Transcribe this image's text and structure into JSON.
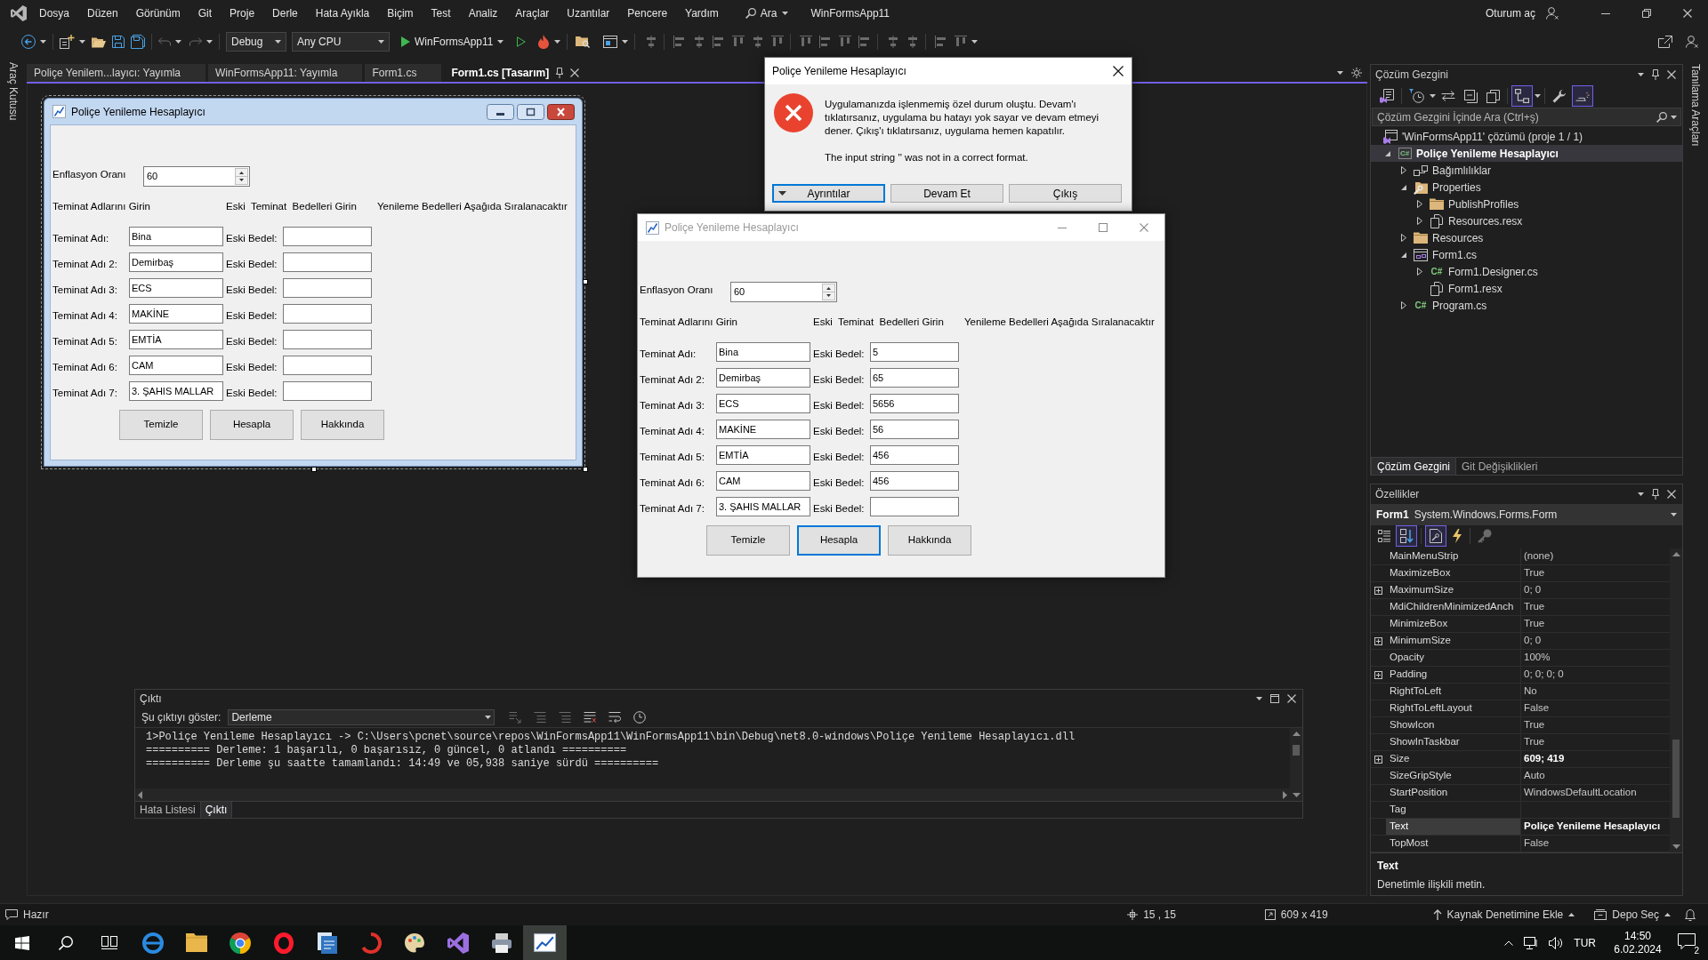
{
  "menu_bar": {
    "items": [
      "Dosya",
      "Düzen",
      "Görünüm",
      "Git",
      "Proje",
      "Derle",
      "Hata Ayıkla",
      "Biçim",
      "Test",
      "Analiz",
      "Araçlar",
      "Uzantılar",
      "Pencere",
      "Yardım"
    ],
    "search": "Ara",
    "solution_name": "WinFormsApp11",
    "sign_in": "Oturum aç"
  },
  "toolbar": {
    "configuration": "Debug",
    "platform": "Any CPU",
    "start_target": "WinFormsApp11"
  },
  "left_side_tab": "Araç Kutusu",
  "document_tabs": [
    {
      "label": "Poliçe Yenilem...layıcı: Yayımla",
      "selected": false
    },
    {
      "label": "WinFormsApp11: Yayımla",
      "selected": false
    },
    {
      "label": "Form1.cs",
      "selected": false
    },
    {
      "label": "Form1.cs [Tasarım]",
      "selected": true
    }
  ],
  "designer_form": {
    "selected": true,
    "title": "Poliçe Yenileme Hesaplayıcı",
    "inflation_label": "Enflasyon Oranı",
    "inflation_value": "60",
    "headers": [
      "Teminat Adlarını Girin",
      "Eski  Teminat  Bedelleri Girin",
      "Yenileme Bedelleri Aşağıda Sıralanacaktır"
    ],
    "rows": [
      {
        "name_label": "Teminat Adı:",
        "name_value": "Bina",
        "old_label": "Eski Bedel:"
      },
      {
        "name_label": "Teminat Adı 2:",
        "name_value": "Demirbaş",
        "old_label": "Eski Bedel:"
      },
      {
        "name_label": "Teminat Adı 3:",
        "name_value": "ECS",
        "old_label": "Eski Bedel:"
      },
      {
        "name_label": "Teminat Adı 4:",
        "name_value": "MAKİNE",
        "old_label": "Eski Bedel:"
      },
      {
        "name_label": "Teminat Adı 5:",
        "name_value": "EMTİA",
        "old_label": "Eski Bedel:"
      },
      {
        "name_label": "Teminat Adı 6:",
        "name_value": "CAM",
        "old_label": "Eski Bedel:"
      },
      {
        "name_label": "Teminat Adı 7:",
        "name_value": "3. ŞAHIS MALLAR",
        "old_label": "Eski Bedel:"
      }
    ],
    "buttons": [
      {
        "label": "Temizle",
        "focused": false
      },
      {
        "label": "Hesapla",
        "focused": false
      },
      {
        "label": "Hakkında",
        "focused": false
      }
    ]
  },
  "error_dialog": {
    "title": "Poliçe Yenileme Hesaplayıcı",
    "message": "Uygulamanızda işlenmemiş özel durum oluştu. Devam'ı tıklatırsanız, uygulama bu hatayı yok sayar ve devam etmeyi dener. Çıkış'ı tıklatırsanız, uygulama hemen kapatılır.",
    "detail": "The input string '' was not in a correct format.",
    "buttons": [
      {
        "label": "Ayrıntılar",
        "kind": "expander",
        "focused": true
      },
      {
        "label": "Devam Et",
        "kind": "plain",
        "focused": false
      },
      {
        "label": "Çıkış",
        "kind": "plain",
        "focused": false
      }
    ]
  },
  "running_form": {
    "active": false,
    "title": "Poliçe Yenileme Hesaplayıcı",
    "inflation_label": "Enflasyon Oranı",
    "inflation_value": "60",
    "headers": [
      "Teminat Adlarını Girin",
      "Eski  Teminat  Bedelleri Girin",
      "Yenileme Bedelleri Aşağıda Sıralanacaktır"
    ],
    "rows": [
      {
        "name_label": "Teminat Adı:",
        "name_value": "Bina",
        "old_label": "Eski Bedel:",
        "old_value": "5"
      },
      {
        "name_label": "Teminat Adı 2:",
        "name_value": "Demirbaş",
        "old_label": "Eski Bedel:",
        "old_value": "65"
      },
      {
        "name_label": "Teminat Adı 3:",
        "name_value": "ECS",
        "old_label": "Eski Bedel:",
        "old_value": "5656"
      },
      {
        "name_label": "Teminat Adı 4:",
        "name_value": "MAKİNE",
        "old_label": "Eski Bedel:",
        "old_value": "56"
      },
      {
        "name_label": "Teminat Adı 5:",
        "name_value": "EMTİA",
        "old_label": "Eski Bedel:",
        "old_value": "456"
      },
      {
        "name_label": "Teminat Adı 6:",
        "name_value": "CAM",
        "old_label": "Eski Bedel:",
        "old_value": "456"
      },
      {
        "name_label": "Teminat Adı 7:",
        "name_value": "3. ŞAHIS MALLAR",
        "old_label": "Eski Bedel:"
      }
    ],
    "buttons": [
      {
        "label": "Temizle",
        "focused": false
      },
      {
        "label": "Hesapla",
        "focused": true
      },
      {
        "label": "Hakkında",
        "focused": false
      }
    ]
  },
  "solution_explorer": {
    "title": "Çözüm Gezgini",
    "toolbar": [
      {
        "kind": "views",
        "selected": false
      },
      {
        "kind": "filter",
        "selected": false
      },
      {
        "kind": "sync",
        "selected": false
      },
      {
        "kind": "collapse",
        "selected": false
      },
      {
        "kind": "copy",
        "selected": false
      },
      {
        "kind": "tree",
        "selected": true
      },
      {
        "kind": "wrench",
        "selected": false
      },
      {
        "kind": "preview",
        "selected": true
      }
    ],
    "search_placeholder": "Çözüm Gezgini İçinde Ara (Ctrl+ş)",
    "tree": [
      {
        "label": "'WinFormsApp11' çözümü (proje 1 / 1)",
        "kind": "solution",
        "selected": false,
        "children": [
          {
            "label": "Poliçe Yenileme Hesaplayıcı",
            "kind": "project",
            "badge": "C#",
            "expanded": true,
            "selected": true,
            "children": [
              {
                "label": "Bağımlılıklar",
                "kind": "dependencies",
                "expanded": false,
                "selected": false
              },
              {
                "label": "Properties",
                "kind": "properties",
                "expanded": true,
                "selected": false,
                "children": [
                  {
                    "label": "PublishProfiles",
                    "kind": "folder",
                    "expanded": false,
                    "selected": false
                  },
                  {
                    "label": "Resources.resx",
                    "kind": "resource",
                    "expanded": false,
                    "selected": false
                  }
                ]
              },
              {
                "label": "Resources",
                "kind": "folder",
                "expanded": false,
                "selected": false
              },
              {
                "label": "Form1.cs",
                "kind": "form",
                "expanded": true,
                "selected": false,
                "children": [
                  {
                    "label": "Form1.Designer.cs",
                    "kind": "csharp",
                    "badge": "C#",
                    "expanded": false,
                    "selected": false
                  },
                  {
                    "label": "Form1.resx",
                    "kind": "resource",
                    "selected": false
                  }
                ]
              },
              {
                "label": "Program.cs",
                "kind": "csharp",
                "badge": "C#",
                "expanded": false,
                "selected": false
              }
            ]
          }
        ]
      }
    ],
    "tabs": [
      {
        "label": "Çözüm Gezgini",
        "selected": true
      },
      {
        "label": "Git Değişiklikleri",
        "selected": false
      }
    ]
  },
  "properties": {
    "title": "Özellikler",
    "object_name": "Form1",
    "object_type": "System.Windows.Forms.Form",
    "toolbar": [
      {
        "kind": "categorized",
        "selected": false
      },
      {
        "kind": "alphabetical",
        "selected": true
      },
      {
        "kind": "properties",
        "selected": true
      },
      {
        "kind": "events",
        "selected": false
      },
      {
        "kind": "pages",
        "selected": false
      }
    ],
    "rows": [
      {
        "name": "MainMenuStrip",
        "value": "(none)",
        "expandable": false,
        "modified": false,
        "selected": false
      },
      {
        "name": "MaximizeBox",
        "value": "True",
        "expandable": false,
        "modified": false,
        "selected": false
      },
      {
        "name": "MaximumSize",
        "value": "0; 0",
        "expandable": true,
        "modified": false,
        "selected": false
      },
      {
        "name": "MdiChildrenMinimizedAnch",
        "value": "True",
        "expandable": false,
        "modified": false,
        "selected": false
      },
      {
        "name": "MinimizeBox",
        "value": "True",
        "expandable": false,
        "modified": false,
        "selected": false
      },
      {
        "name": "MinimumSize",
        "value": "0; 0",
        "expandable": true,
        "modified": false,
        "selected": false
      },
      {
        "name": "Opacity",
        "value": "100%",
        "expandable": false,
        "modified": false,
        "selected": false
      },
      {
        "name": "Padding",
        "value": "0; 0; 0; 0",
        "expandable": true,
        "modified": false,
        "selected": false
      },
      {
        "name": "RightToLeft",
        "value": "No",
        "expandable": false,
        "modified": false,
        "selected": false
      },
      {
        "name": "RightToLeftLayout",
        "value": "False",
        "expandable": false,
        "modified": false,
        "selected": false
      },
      {
        "name": "ShowIcon",
        "value": "True",
        "expandable": false,
        "modified": false,
        "selected": false
      },
      {
        "name": "ShowInTaskbar",
        "value": "True",
        "expandable": false,
        "modified": false,
        "selected": false
      },
      {
        "name": "Size",
        "value": "609; 419",
        "expandable": true,
        "modified": true,
        "selected": false
      },
      {
        "name": "SizeGripStyle",
        "value": "Auto",
        "expandable": false,
        "modified": false,
        "selected": false
      },
      {
        "name": "StartPosition",
        "value": "WindowsDefaultLocation",
        "expandable": false,
        "modified": false,
        "selected": false
      },
      {
        "name": "Tag",
        "expandable": false,
        "selected": false
      },
      {
        "name": "Text",
        "value": "Poliçe Yenileme Hesaplayıcı",
        "expandable": false,
        "modified": true,
        "selected": true
      },
      {
        "name": "TopMost",
        "value": "False",
        "expandable": false,
        "modified": false,
        "selected": false
      }
    ],
    "description_title": "Text",
    "description": "Denetimle ilişkili metin."
  },
  "output": {
    "title": "Çıktı",
    "source_label": "Şu çıktıyı göster:",
    "source_value": "Derleme",
    "lines": [
      "1>Poliçe Yenileme Hesaplayıcı -> C:\\Users\\pcnet\\source\\repos\\WinFormsApp11\\WinFormsApp11\\bin\\Debug\\net8.0-windows\\Poliçe Yenileme Hesaplayıcı.dll",
      "========== Derleme: 1 başarılı, 0 başarısız, 0 güncel, 0 atlandı ==========",
      "========== Derleme şu saatte tamamlandı: 14:49 ve 05,938 saniye sürdü =========="
    ],
    "tabs": [
      {
        "label": "Hata Listesi",
        "selected": false
      },
      {
        "label": "Çıktı",
        "selected": true
      }
    ]
  },
  "right_side_tab": "Tanılama Araçları",
  "status_bar": {
    "message": "Hazır",
    "position": "15 , 15",
    "size": "609 x 419",
    "source_control": "Kaynak Denetimine Ekle",
    "repository": "Depo Seç"
  },
  "taskbar": {
    "apps": [
      {
        "kind": "circle_bar",
        "selected": false
      },
      {
        "kind": "folder",
        "selected": false
      },
      {
        "kind": "segmented_circle",
        "selected": false
      },
      {
        "kind": "ring",
        "selected": false
      },
      {
        "kind": "document_stack",
        "selected": false
      },
      {
        "kind": "arc",
        "selected": false
      },
      {
        "kind": "palette",
        "selected": false
      },
      {
        "kind": "ribbon",
        "selected": false
      },
      {
        "kind": "printer",
        "selected": false
      },
      {
        "kind": "chart",
        "selected": true
      }
    ],
    "language": "TUR",
    "time": "14:50",
    "date": "6.02.2024",
    "notifications": "2"
  }
}
